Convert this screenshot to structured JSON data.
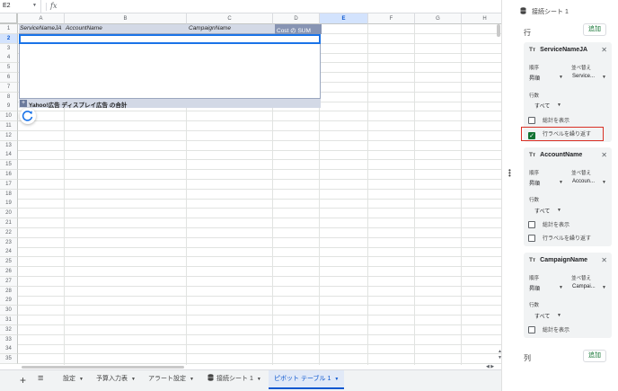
{
  "formula_bar": {
    "cell_ref": "E2",
    "fx": "fx",
    "formula": ""
  },
  "columns": [
    "A",
    "B",
    "C",
    "D",
    "E",
    "F",
    "G",
    "H"
  ],
  "selected_column": "E",
  "rows": [
    "1",
    "2",
    "3",
    "4",
    "5",
    "6",
    "7",
    "8",
    "9",
    "10",
    "11",
    "12",
    "13",
    "14",
    "15",
    "16",
    "17",
    "18",
    "19",
    "20",
    "21",
    "22",
    "23",
    "24",
    "25",
    "26",
    "27",
    "28",
    "29",
    "30",
    "31",
    "32",
    "33",
    "34",
    "35"
  ],
  "selected_row": "2",
  "pivot": {
    "headers": [
      "ServiceNameJA",
      "AccountName",
      "CampaignName",
      "Cost の SUM"
    ],
    "total_label": "Yahoo!広告 ディスプレイ広告 の合計",
    "expand_glyph": "+"
  },
  "tabs": {
    "add_glyph": "+",
    "menu_glyph": "≡",
    "items": [
      {
        "label": "設定",
        "active": false
      },
      {
        "label": "予算入力表",
        "active": false
      },
      {
        "label": "アラート設定",
        "active": false
      },
      {
        "label": "接続シート 1",
        "active": false,
        "icon": "database-icon"
      },
      {
        "label": "ピボット テーブル 1",
        "active": true
      }
    ]
  },
  "panel": {
    "title": "接続シート 1",
    "rows_section": "行",
    "add_label": "追加",
    "columns_section": "列",
    "field_type_glyph": "Tт",
    "close_glyph": "✕",
    "order_label": "順序",
    "sort_by_label": "並べ替え",
    "rows_count_label": "行数",
    "show_total_label": "総計を表示",
    "repeat_labels_label": "行ラベルを繰り返す",
    "fields": [
      {
        "name": "ServiceNameJA",
        "order": "昇順",
        "sort_by": "Service...",
        "rows": "すべて",
        "show_total": false,
        "repeat_labels": true
      },
      {
        "name": "AccountName",
        "order": "昇順",
        "sort_by": "Accoun...",
        "rows": "すべて",
        "show_total": false,
        "repeat_labels": false
      },
      {
        "name": "CampaignName",
        "order": "昇順",
        "sort_by": "Campai...",
        "rows": "すべて",
        "show_total": false
      }
    ]
  },
  "colors": {
    "accent": "#0b57d0",
    "pivot_header": "#d3d9e6",
    "pivot_sum_header": "#8794b3",
    "checkbox_on": "#137333",
    "highlight": "#d93025"
  }
}
